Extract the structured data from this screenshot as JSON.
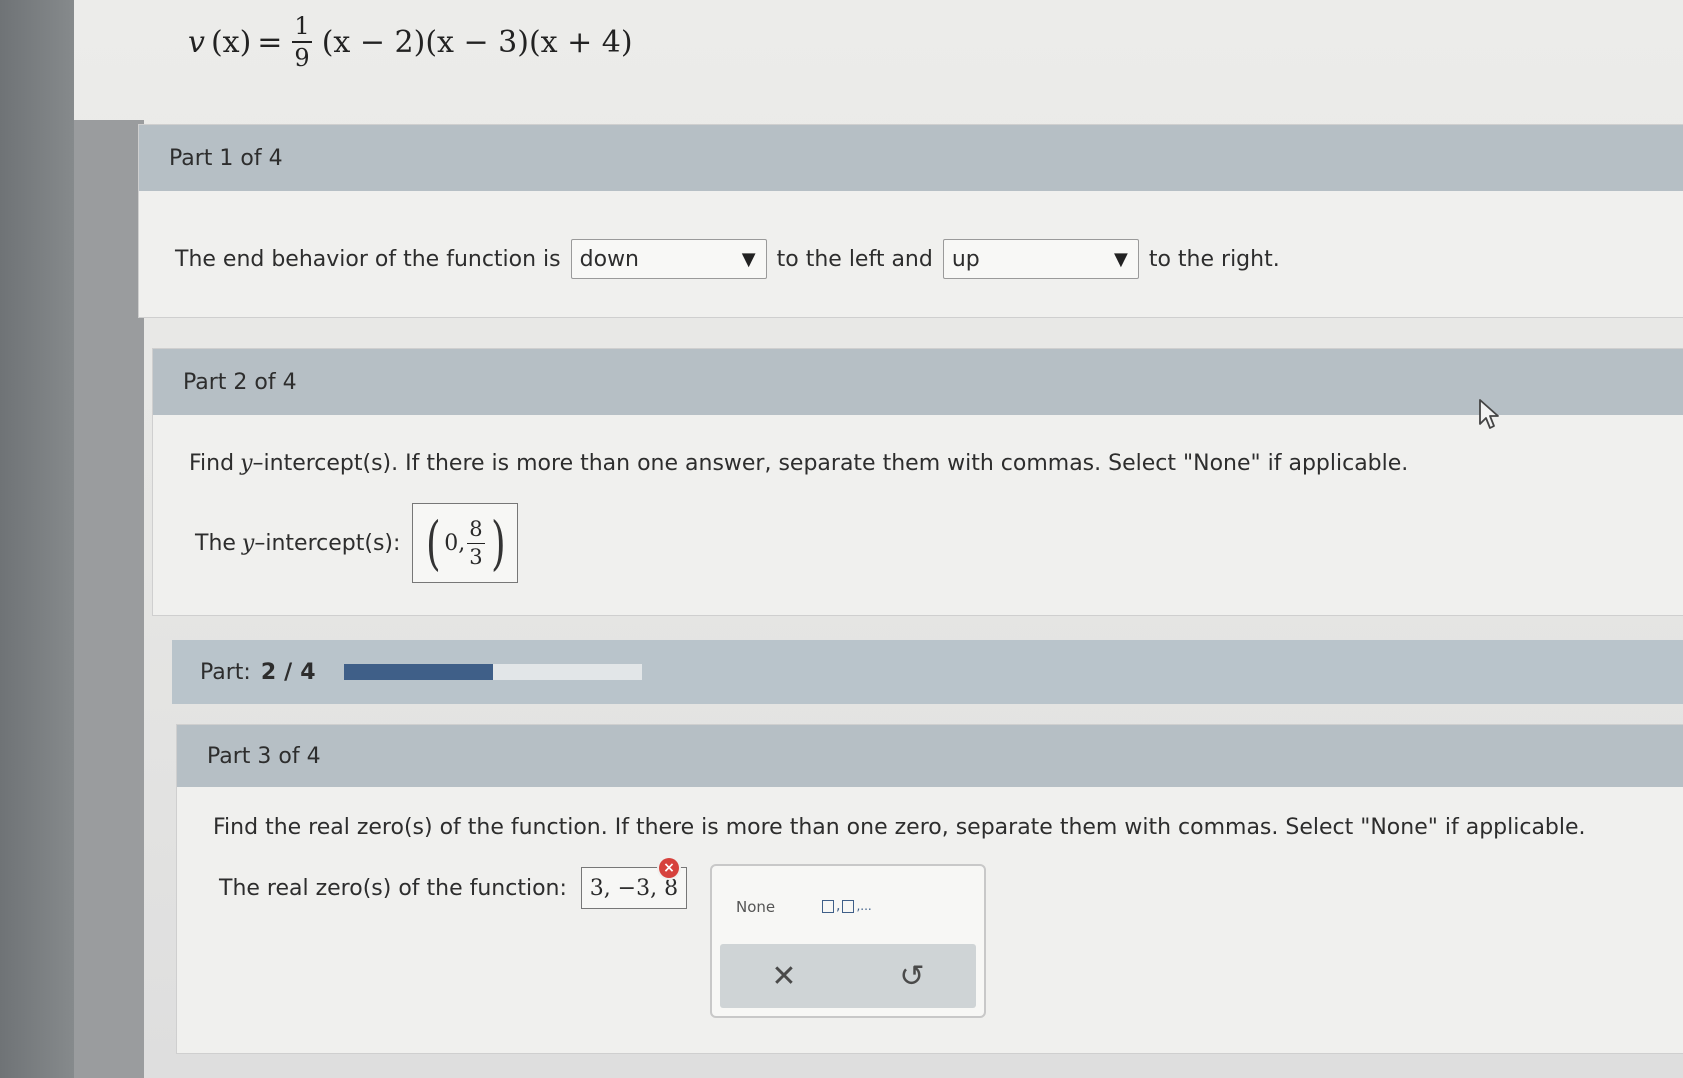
{
  "equation": {
    "lhs_fn": "v",
    "lhs_arg": "(x)",
    "equals": "=",
    "frac_num": "1",
    "frac_den": "9",
    "factors": "(x − 2)(x − 3)(x + 4)"
  },
  "part1": {
    "header": "Part 1 of 4",
    "prefix": "The end behavior of the function is",
    "dropdown_left": "down",
    "middle": "to the left and",
    "dropdown_right": "up",
    "suffix": "to the right."
  },
  "part2": {
    "header": "Part 2 of 4",
    "instruction_pre": "Find",
    "instruction_var": "y",
    "instruction_post": "–intercept(s). If there is more than one answer, separate them with commas. Select \"None\" if applicable.",
    "label_pre": "The",
    "label_var": "y",
    "label_post": "–intercept(s):",
    "answer_x": "0,",
    "answer_num": "8",
    "answer_den": "3"
  },
  "progress": {
    "label": "Part:",
    "current": "2",
    "separator": "/",
    "total": "4",
    "fraction": 0.5
  },
  "part3": {
    "header": "Part 3 of 4",
    "instruction": "Find the real zero(s) of the function. If there is more than one zero, separate them with commas. Select \"None\" if applicable.",
    "label": "The real zero(s) of the function:",
    "answer": "3, −3, 8",
    "error_mark": "×"
  },
  "palette": {
    "none_label": "None",
    "list_suffix": ",...",
    "clear_icon": "✕",
    "undo_icon": "↺"
  },
  "colors": {
    "header_bg": "#b6bfc5",
    "progress_fill": "#3f5f88",
    "error": "#d6413c"
  }
}
